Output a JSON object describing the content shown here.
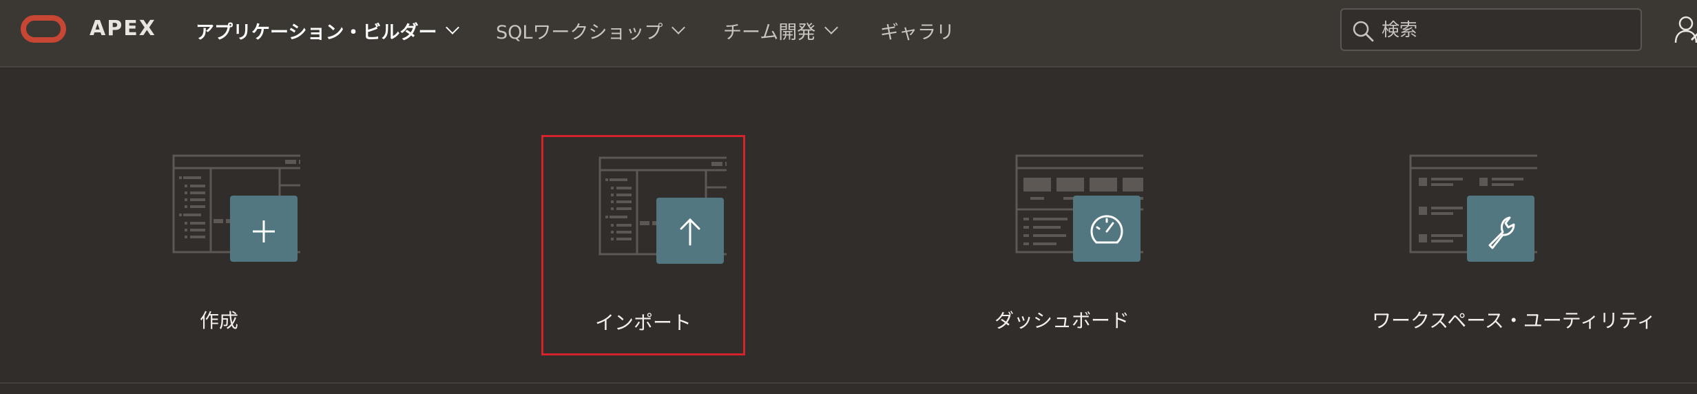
{
  "header": {
    "brand": "APEX",
    "nav": [
      {
        "label": "アプリケーション・ビルダー",
        "active": true,
        "dropdown": true
      },
      {
        "label": "SQLワークショップ",
        "active": false,
        "dropdown": true
      },
      {
        "label": "チーム開発",
        "active": false,
        "dropdown": true
      },
      {
        "label": "ギャラリ",
        "active": false,
        "dropdown": false
      }
    ],
    "search": {
      "placeholder": "検索",
      "value": ""
    },
    "icons": [
      "oracle-logo",
      "search-icon",
      "user-icon",
      "chevron-down-icon"
    ]
  },
  "tiles": [
    {
      "label": "作成",
      "icon": "plus-icon",
      "selected": false
    },
    {
      "label": "インポート",
      "icon": "upload-arrow-icon",
      "selected": true
    },
    {
      "label": "ダッシュボード",
      "icon": "speedometer-icon",
      "selected": false
    },
    {
      "label": "ワークスペース・ユーティリティ",
      "icon": "wrench-icon",
      "selected": false
    }
  ],
  "colors": {
    "background": "#312d2a",
    "header": "#3b3733",
    "oracle_red": "#c74634",
    "tile_badge": "#527780",
    "selection_outline": "#d4232b"
  }
}
